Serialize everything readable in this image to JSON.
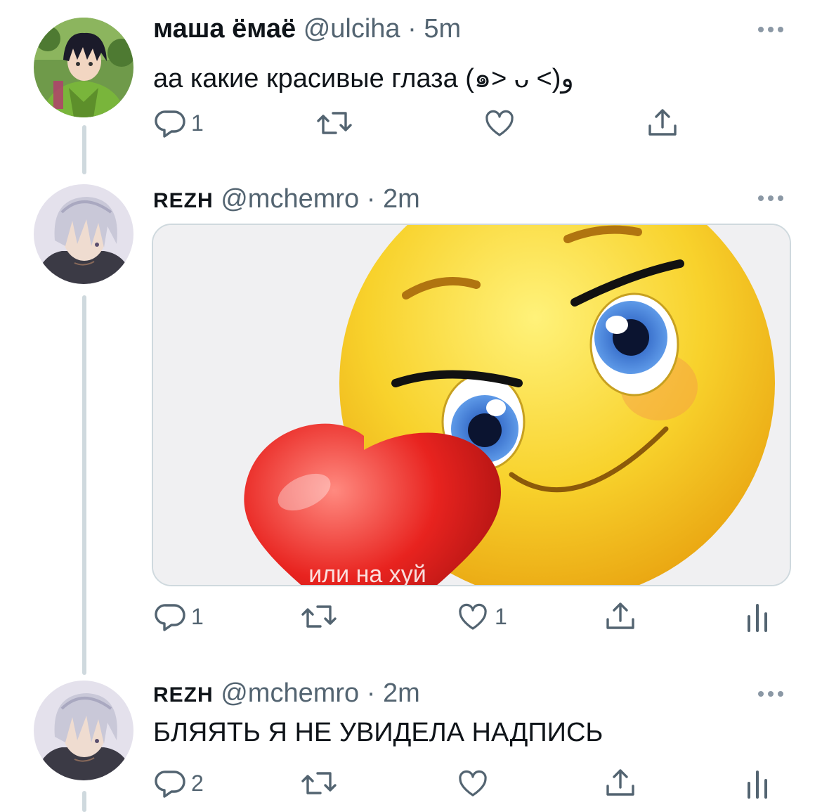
{
  "tweets": [
    {
      "name": "маша ёмаё",
      "handle": "@ulciha",
      "sep": "·",
      "time": "5m",
      "text": "аа какие красивые глаза (๑˃ ᴗ ˂)ﻭ",
      "replies": "1",
      "retweets": "",
      "likes": "",
      "avatar": "anime-boy-green-hoodie"
    },
    {
      "name": "REZH",
      "handle": "@mchemro",
      "sep": "·",
      "time": "2m",
      "text": "",
      "image_caption": "или на хуй",
      "replies": "1",
      "retweets": "",
      "likes": "1",
      "avatar": "anime-white-hair"
    },
    {
      "name": "REZH",
      "handle": "@mchemro",
      "sep": "·",
      "time": "2m",
      "text": "БЛЯЯТЬ Я НЕ УВИДЕЛА НАДПИСЬ",
      "replies": "2",
      "retweets": "",
      "likes": "",
      "avatar": "anime-white-hair"
    }
  ],
  "icons": {
    "reply": "reply-icon",
    "retweet": "retweet-icon",
    "like": "heart-icon",
    "share": "share-icon",
    "analytics": "analytics-icon",
    "more": "more-icon"
  },
  "colors": {
    "text": "#0f1419",
    "secondary": "#536471",
    "thread_line": "#cfd9de",
    "emoji_yellow": "#f7c51a",
    "heart_red": "#e8231f"
  }
}
